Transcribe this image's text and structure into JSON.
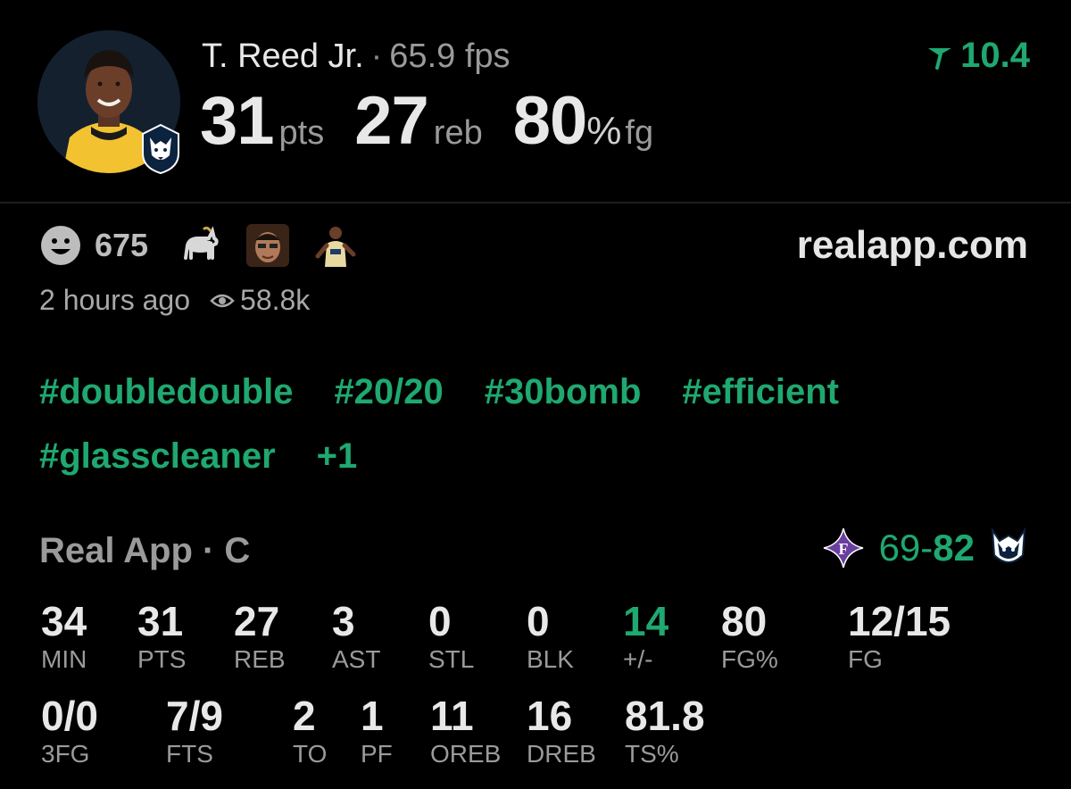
{
  "header": {
    "player_name": "T. Reed Jr.",
    "separator": "·",
    "fps": "65.9 fps",
    "rating_value": "10.4",
    "stats": {
      "points": "31",
      "points_unit": "pts",
      "rebounds": "27",
      "rebounds_unit": "reb",
      "fg_pct": "80",
      "pct_sign": "%",
      "fg_unit": "fg"
    }
  },
  "social": {
    "reaction_count": "675",
    "reactions": [
      "goat-emoji",
      "face-reaction",
      "player-reaction"
    ],
    "site": "realapp.com",
    "posted": "2 hours ago",
    "views": "58.8k"
  },
  "tags": {
    "row1": [
      "#doubledouble",
      "#20/20",
      "#30bomb",
      "#efficient"
    ],
    "row2": [
      "#glasscleaner",
      "+1"
    ]
  },
  "game": {
    "source": "Real App · C",
    "score_away": "69",
    "score_dash": "-",
    "score_home": "82"
  },
  "stat_grid": {
    "row1": [
      {
        "value": "34",
        "label": "MIN"
      },
      {
        "value": "31",
        "label": "PTS"
      },
      {
        "value": "27",
        "label": "REB"
      },
      {
        "value": "3",
        "label": "AST"
      },
      {
        "value": "0",
        "label": "STL"
      },
      {
        "value": "0",
        "label": "BLK"
      },
      {
        "value": "14",
        "label": "+/-"
      },
      {
        "value": "80",
        "label": "FG%"
      },
      {
        "value": "12/15",
        "label": "FG"
      }
    ],
    "row2": [
      {
        "value": "0/0",
        "label": "3FG"
      },
      {
        "value": "7/9",
        "label": "FTS"
      },
      {
        "value": "2",
        "label": "TO"
      },
      {
        "value": "1",
        "label": "PF"
      },
      {
        "value": "11",
        "label": "OREB"
      },
      {
        "value": "16",
        "label": "DREB"
      },
      {
        "value": "81.8",
        "label": "TS%"
      }
    ]
  },
  "colors": {
    "background": "#000000",
    "accent_green": "#1fa870",
    "muted_text": "#9a9a9a",
    "primary_text": "#e8e8e8",
    "divider": "#1e1e1e"
  }
}
